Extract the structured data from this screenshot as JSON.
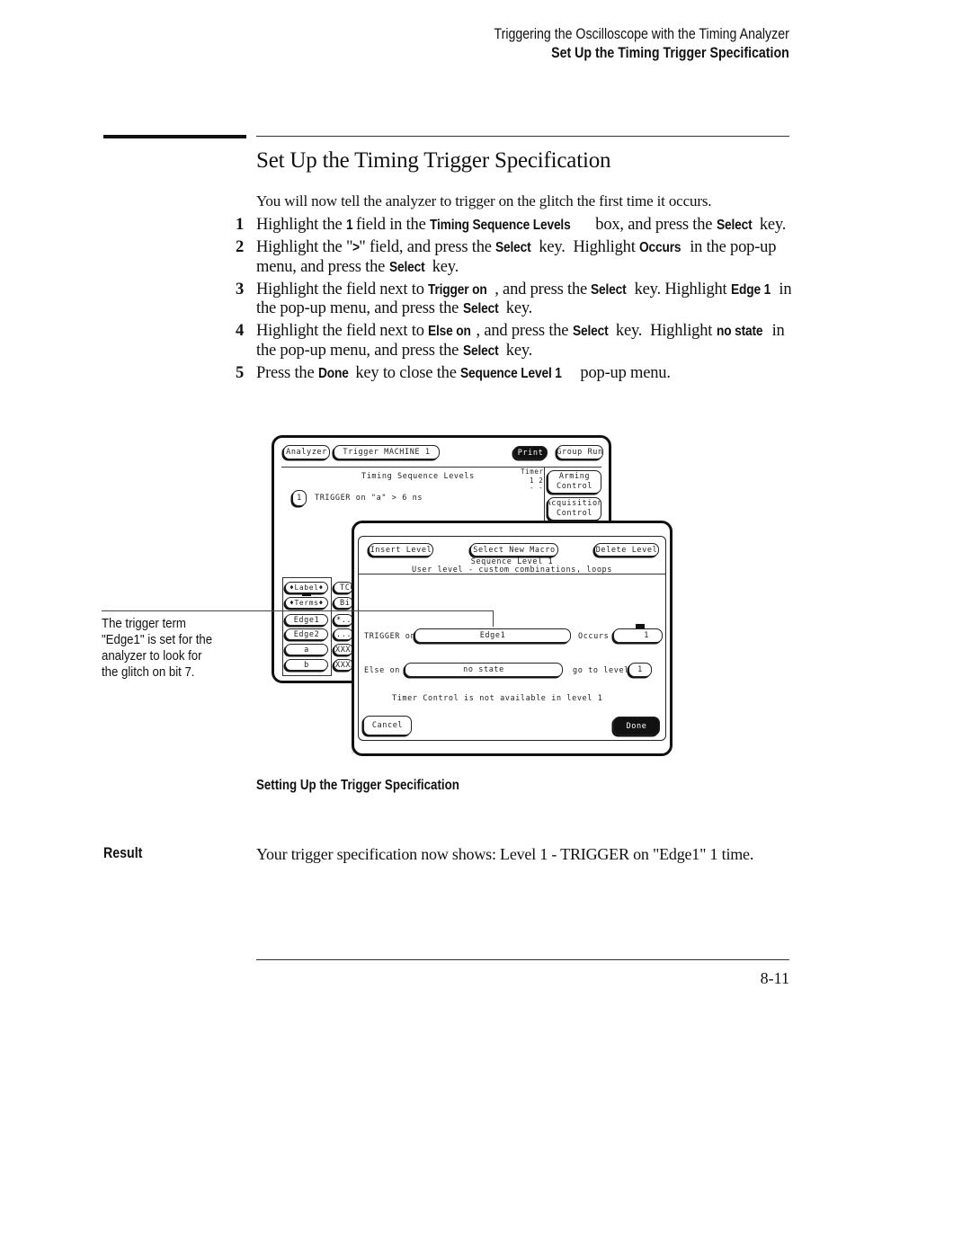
{
  "running_header": {
    "chapter": "Triggering the Oscilloscope with the Timing Analyzer",
    "section": "Set Up the Timing Trigger Specification"
  },
  "section": {
    "title": "Set Up the Timing Trigger Specification",
    "intro": "You will now tell the analyzer to trigger on the glitch the first time it occurs."
  },
  "steps": [
    {
      "num": "1",
      "parts": [
        {
          "t": "Highlight the "
        },
        {
          "k": "1"
        },
        {
          "t": " field in the "
        },
        {
          "k": "Timing Sequence Levels"
        },
        {
          "t": " box, and press the "
        },
        {
          "k": "Select"
        },
        {
          "t": " key."
        }
      ]
    },
    {
      "num": "2",
      "parts": [
        {
          "t": "Highlight the \""
        },
        {
          "k": ">"
        },
        {
          "t": "\" field, and press the "
        },
        {
          "k": "Select"
        },
        {
          "t": " key.  Highlight "
        },
        {
          "k": "Occurs"
        },
        {
          "t": " in the pop-up menu, and press the "
        },
        {
          "k": "Select"
        },
        {
          "t": " key."
        }
      ]
    },
    {
      "num": "3",
      "parts": [
        {
          "t": "Highlight the field next to "
        },
        {
          "k": "Trigger on"
        },
        {
          "t": ", and press the "
        },
        {
          "k": "Select"
        },
        {
          "t": " key. Highlight "
        },
        {
          "k": "Edge 1"
        },
        {
          "t": " in the pop-up menu, and press the "
        },
        {
          "k": "Select"
        },
        {
          "t": " key."
        }
      ]
    },
    {
      "num": "4",
      "parts": [
        {
          "t": "Highlight the field next to "
        },
        {
          "k": "Else on"
        },
        {
          "t": ", and press the "
        },
        {
          "k": "Select"
        },
        {
          "t": " key.  Highlight "
        },
        {
          "k": "no state"
        },
        {
          "t": " in the pop-up menu, and press the "
        },
        {
          "k": "Select"
        },
        {
          "t": " key."
        }
      ]
    },
    {
      "num": "5",
      "parts": [
        {
          "t": "Press the "
        },
        {
          "k": "Done"
        },
        {
          "t": " key to close the "
        },
        {
          "k": "Sequence Level 1"
        },
        {
          "t": " pop-up menu."
        }
      ]
    }
  ],
  "screen": {
    "analyzer_button": "Analyzer",
    "trigger_button": "Trigger  MACHINE 1",
    "print_button": "Print",
    "group_run_button": "Group Run",
    "timing_sequence_title": "Timing Sequence Levels",
    "timer_label": "Timer",
    "timer_cols": "1 2",
    "timer_vals": "- -",
    "arming_control": [
      "Arming",
      "Control"
    ],
    "acquisition_control": [
      "Acquisition",
      "Control"
    ],
    "level_1_button": "1",
    "level_1_text": "TRIGGER on \"a\" > 6 ns",
    "label_button": "♦Label♦",
    "terms_button": "♦Terms♦",
    "terms": [
      "Edge1",
      "Edge2",
      "a",
      "b"
    ],
    "term_values_partial": [
      "TCC",
      "Bi",
      "*..",
      "...",
      "XXXX",
      "XXXX"
    ]
  },
  "popup": {
    "insert_level": "Insert Level",
    "select_new_macro": "Select New Macro",
    "delete_level": "Delete Level",
    "sequence_level": "Sequence Level 1",
    "user_level": "User level - custom combinations, loops",
    "trigger_on_label": "TRIGGER on",
    "trigger_on_value": "Edge1",
    "occurs_label": "Occurs",
    "occurs_value": "1",
    "else_on_label": "Else on",
    "else_on_value": "no state",
    "go_to_level_label": "go to level",
    "go_to_level_value": "1",
    "timer_note": "Timer Control is not available in level 1",
    "cancel_button": "Cancel",
    "done_button": "Done"
  },
  "callout": {
    "lines": [
      "The trigger term",
      "\"Edge1\" is set for the",
      "analyzer to look for",
      "the glitch on bit 7."
    ]
  },
  "figure_caption": "Setting Up the Trigger Specification",
  "result": {
    "label": "Result",
    "text": "Your trigger specification now shows:  Level 1 - TRIGGER on \"Edge1\" 1 time."
  },
  "page_number": "8-11"
}
